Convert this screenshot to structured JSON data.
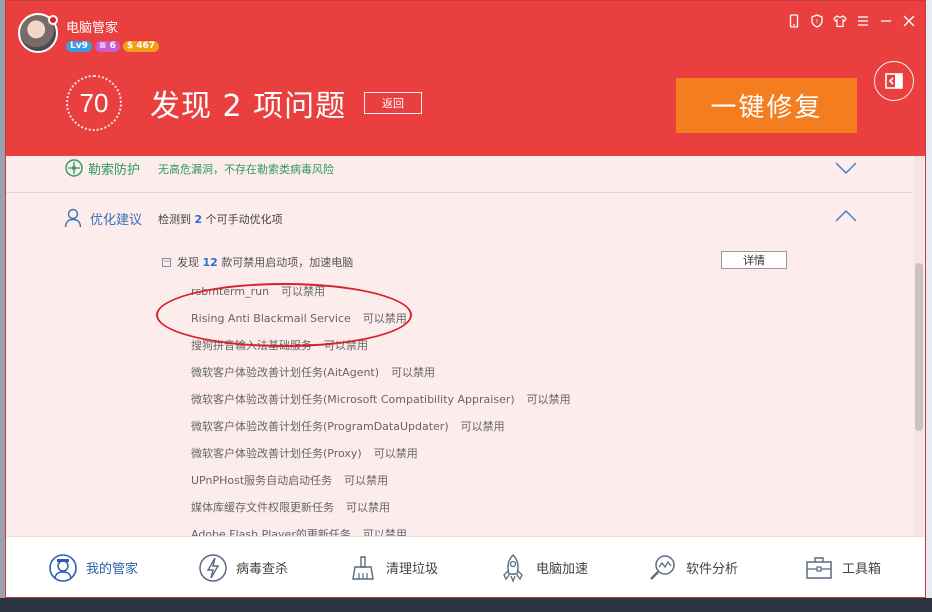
{
  "header": {
    "app_title": "电脑管家",
    "badges": {
      "level": "Lv9",
      "vip": "6",
      "coins": "$ 467"
    },
    "score": "70",
    "headline": "发现 2 项问题",
    "back_label": "返回",
    "fix_label": "一键修复"
  },
  "ransom": {
    "label": "勒索防护",
    "desc": "无高危漏洞，不存在勒索类病毒风险"
  },
  "optimize": {
    "label": "优化建议",
    "desc_prefix": "检测到",
    "count": "2",
    "desc_suffix": "个可手动优化项",
    "sub_prefix": "发现",
    "sub_count": "12",
    "sub_suffix": "款可禁用启动项，加速电脑",
    "detail_label": "详情",
    "items": [
      {
        "name": "rsbmterm_run",
        "action": "可以禁用"
      },
      {
        "name": "Rising Anti Blackmail Service",
        "action": "可以禁用"
      },
      {
        "name": "搜狗拼音输入法基础服务",
        "action": "可以禁用"
      },
      {
        "name": "微软客户体验改善计划任务(AitAgent)",
        "action": "可以禁用"
      },
      {
        "name": "微软客户体验改善计划任务(Microsoft Compatibility Appraiser)",
        "action": "可以禁用"
      },
      {
        "name": "微软客户体验改善计划任务(ProgramDataUpdater)",
        "action": "可以禁用"
      },
      {
        "name": "微软客户体验改善计划任务(Proxy)",
        "action": "可以禁用"
      },
      {
        "name": "UPnPHost服务自动启动任务",
        "action": "可以禁用"
      },
      {
        "name": "媒体库缓存文件权限更新任务",
        "action": "可以禁用"
      },
      {
        "name": "Adobe Flash Player的更新任务",
        "action": "可以禁用"
      }
    ]
  },
  "nav": [
    {
      "label": "我的管家",
      "icon": "butler-icon"
    },
    {
      "label": "病毒查杀",
      "icon": "virus-scan-icon"
    },
    {
      "label": "清理垃圾",
      "icon": "cleanup-icon"
    },
    {
      "label": "电脑加速",
      "icon": "rocket-icon"
    },
    {
      "label": "软件分析",
      "icon": "software-analysis-icon"
    },
    {
      "label": "工具箱",
      "icon": "toolbox-icon"
    }
  ],
  "colors": {
    "header": "#e9403f",
    "fix_button": "#f47e1f",
    "green": "#2f9a5a",
    "blue": "#3d6fb4"
  }
}
